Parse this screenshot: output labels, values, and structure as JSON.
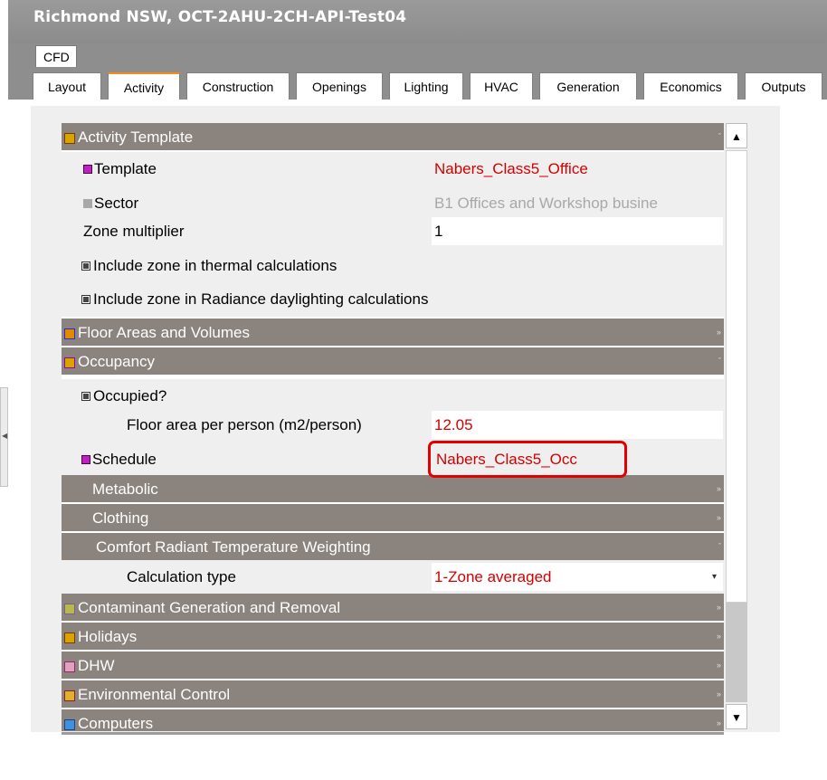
{
  "window": {
    "title": "Richmond NSW, OCT-2AHU-2CH-API-Test04"
  },
  "top_tab": "CFD",
  "tabs": [
    {
      "label": "Layout",
      "active": false
    },
    {
      "label": "Activity",
      "active": true
    },
    {
      "label": "Construction",
      "active": false
    },
    {
      "label": "Openings",
      "active": false
    },
    {
      "label": "Lighting",
      "active": false
    },
    {
      "label": "HVAC",
      "active": false
    },
    {
      "label": "Generation",
      "active": false
    },
    {
      "label": "Economics",
      "active": false
    },
    {
      "label": "Outputs",
      "active": false
    }
  ],
  "activity": {
    "activity_template_header": "Activity Template",
    "template_label": "Template",
    "template_value": "Nabers_Class5_Office",
    "sector_label": "Sector",
    "sector_value": "B1 Offices and Workshop busine",
    "zone_multiplier_label": "Zone multiplier",
    "zone_multiplier_value": "1",
    "include_thermal_label": "Include zone in thermal calculations",
    "include_thermal_checked": true,
    "include_radiance_label": "Include zone in Radiance daylighting calculations",
    "include_radiance_checked": true,
    "floor_areas_header": "Floor Areas and Volumes",
    "occupancy_header": "Occupancy",
    "occupied_label": "Occupied?",
    "occupied_checked": true,
    "floor_area_per_person_label": "Floor area per person (m2/person)",
    "floor_area_per_person_value": "12.05",
    "schedule_label": "Schedule",
    "schedule_value": "Nabers_Class5_Occ",
    "metabolic_header": "Metabolic",
    "clothing_header": "Clothing",
    "comfort_header": "Comfort Radiant Temperature Weighting",
    "calc_type_label": "Calculation type",
    "calc_type_value": "1-Zone averaged",
    "contaminant_header": "Contaminant Generation and Removal",
    "holidays_header": "Holidays",
    "dhw_header": "DHW",
    "env_control_header": "Environmental Control",
    "computers_header": "Computers"
  },
  "colors": {
    "header_bg": "#8b847e",
    "value_red": "#d40000",
    "link_navy": "#1a2a8c",
    "active_tab_accent": "#f28c1a",
    "highlight_red": "#e30000"
  },
  "icons": {
    "group": "group-icon",
    "collapse": "chevron-up-icon",
    "expand": "chevron-down-icon",
    "scroll_up": "scroll-up-arrow-icon",
    "scroll_down": "scroll-down-arrow-icon",
    "dropdown": "dropdown-arrow-icon"
  }
}
